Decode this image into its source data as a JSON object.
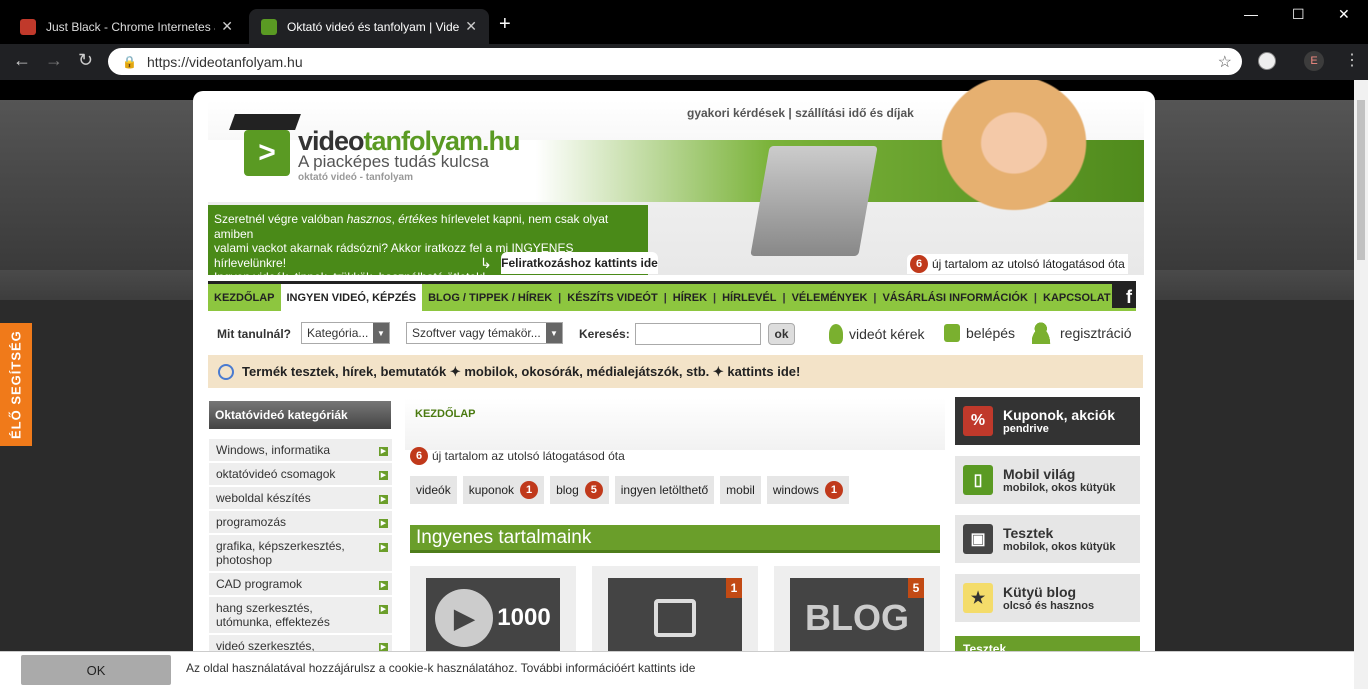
{
  "browser": {
    "tabs": [
      {
        "title": "Just Black - Chrome Internetes ár",
        "active": false,
        "favicon_color": "#c0392b"
      },
      {
        "title": "Oktató videó és tanfolyam | Vide",
        "active": true,
        "favicon_color": "#5a9a23"
      }
    ],
    "new_tab": "+",
    "url": "https://videotanfolyam.hu",
    "profile_initial": "E"
  },
  "live_help": "ÉLŐ SEGÍTSÉG",
  "header": {
    "logo_prefix": "video",
    "logo_suffix": "tanfolyam.hu",
    "slogan": "A piacképes tudás kulcsa",
    "subslogan": "oktató videó - tanfolyam",
    "top_links": "gyakori kérdések | szállítási idő és díjak",
    "newsletter_line1_a": "Szeretnél végre valóban ",
    "newsletter_line1_b": "hasznos",
    "newsletter_line1_c": ", ",
    "newsletter_line1_d": "értékes",
    "newsletter_line1_e": " hírlevelet kapni, nem csak olyat amiben",
    "newsletter_line2": "valami vackot akarnak rádsózni? Akkor iratkozz fel a mi INGYENES hírlevelünkre!",
    "newsletter_line3": "Ingyen videók, tippek, trükkök, használható ötletek!",
    "subscribe": "Feliratkozáshoz kattints ide",
    "new_count": "6",
    "new_text": "új tartalom az utolsó látogatásod óta"
  },
  "nav": [
    "KEZDŐLAP",
    "INGYEN VIDEÓ, KÉPZÉS",
    "BLOG / TIPPEK / HÍREK",
    "KÉSZÍTS VIDEÓT",
    "HÍREK",
    "HÍRLEVÉL",
    "VÉLEMÉNYEK",
    "VÁSÁRLÁSI INFORMÁCIÓK",
    "KAPCSOLAT"
  ],
  "nav_active": "INGYEN VIDEÓ, KÉPZÉS",
  "search": {
    "label": "Mit tanulnál?",
    "category": "Kategória...",
    "topic": "Szoftver vagy témakör...",
    "search_label": "Keresés:",
    "ok": "ok",
    "request": "videót kérek",
    "login": "belépés",
    "register": "regisztráció"
  },
  "promo": "Termék tesztek, hírek, bemutatók  ✦  mobilok, okosórák, médialejátszók, stb.  ✦  kattints ide!",
  "sidebar": {
    "title": "Oktatóvideó kategóriák",
    "items": [
      "Windows, informatika",
      "oktatóvideó csomagok",
      "weboldal készítés",
      "programozás",
      "grafika, képszerkesztés, photoshop",
      "CAD programok",
      "hang szerkesztés, utómunka, effektezés",
      "videó szerkesztés,"
    ]
  },
  "main": {
    "breadcrumb": "KEZDŐLAP",
    "last_count": "6",
    "last_text": "új tartalom az utolsó látogatásod óta",
    "tags": [
      {
        "label": "videók",
        "count": ""
      },
      {
        "label": "kuponok",
        "count": "1"
      },
      {
        "label": "blog",
        "count": "5"
      },
      {
        "label": "ingyen letölthető",
        "count": ""
      },
      {
        "label": "mobil",
        "count": ""
      },
      {
        "label": "windows",
        "count": "1"
      }
    ],
    "free_title": "Ingyenes tartalmaink",
    "cards": [
      {
        "tile": "1000",
        "count": ""
      },
      {
        "tile": "",
        "count": "1"
      },
      {
        "tile": "BLOG",
        "count": "5"
      }
    ]
  },
  "right": [
    {
      "title": "Kuponok, akciók",
      "sub": "pendrive",
      "icon": "%"
    },
    {
      "title": "Mobil világ",
      "sub": "mobilok, okos kütyük",
      "icon": "▯"
    },
    {
      "title": "Tesztek",
      "sub": "mobilok, okos kütyük",
      "icon": "▣"
    },
    {
      "title": "Kütyü blog",
      "sub": "olcsó és hasznos",
      "icon": "★"
    }
  ],
  "right_section": "Tesztek",
  "cookie": {
    "ok": "OK",
    "text": "Az oldal használatával hozzájárulsz a cookie-k használatához. További információért kattints ide"
  }
}
